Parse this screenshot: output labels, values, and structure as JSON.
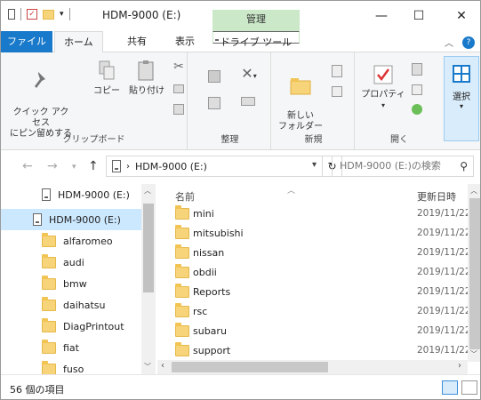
{
  "window": {
    "title": "HDM-9000 (E:)",
    "context_tab": "管理"
  },
  "ribbon_tabs": {
    "file": "ファイル",
    "home": "ホーム",
    "share": "共有",
    "view": "表示",
    "drive_tools": "ドライブ ツール"
  },
  "ribbon": {
    "pin_quick_access": "クイック アクセス\nにピン留めする",
    "copy": "コピー",
    "paste": "貼り付け",
    "group_clipboard": "クリップボード",
    "group_organize": "整理",
    "new_folder": "新しい\nフォルダー",
    "group_new": "新規",
    "properties": "プロパティ",
    "group_open": "開く",
    "select": "選択"
  },
  "address": {
    "path": "HDM-9000 (E:)",
    "search_placeholder": "HDM-9000 (E:)の検索"
  },
  "nav_pane": {
    "items": [
      {
        "label": "HDM-9000 (E:)",
        "type": "drive"
      },
      {
        "label": "HDM-9000 (E:)",
        "type": "drive"
      },
      {
        "label": "alfaromeo",
        "type": "folder"
      },
      {
        "label": "audi",
        "type": "folder"
      },
      {
        "label": "bmw",
        "type": "folder"
      },
      {
        "label": "daihatsu",
        "type": "folder"
      },
      {
        "label": "DiagPrintout",
        "type": "folder"
      },
      {
        "label": "fiat",
        "type": "folder"
      },
      {
        "label": "fuso",
        "type": "folder"
      }
    ]
  },
  "file_list": {
    "col_name": "名前",
    "col_modified": "更新日時",
    "rows": [
      {
        "name": "mini",
        "date": "2019/11/22"
      },
      {
        "name": "mitsubishi",
        "date": "2019/11/22"
      },
      {
        "name": "nissan",
        "date": "2019/11/22"
      },
      {
        "name": "obdii",
        "date": "2019/11/22"
      },
      {
        "name": "Reports",
        "date": "2019/11/22"
      },
      {
        "name": "rsc",
        "date": "2019/11/22"
      },
      {
        "name": "subaru",
        "date": "2019/11/22"
      },
      {
        "name": "support",
        "date": "2019/11/22"
      }
    ]
  },
  "status": {
    "item_count": "56 個の項目"
  }
}
